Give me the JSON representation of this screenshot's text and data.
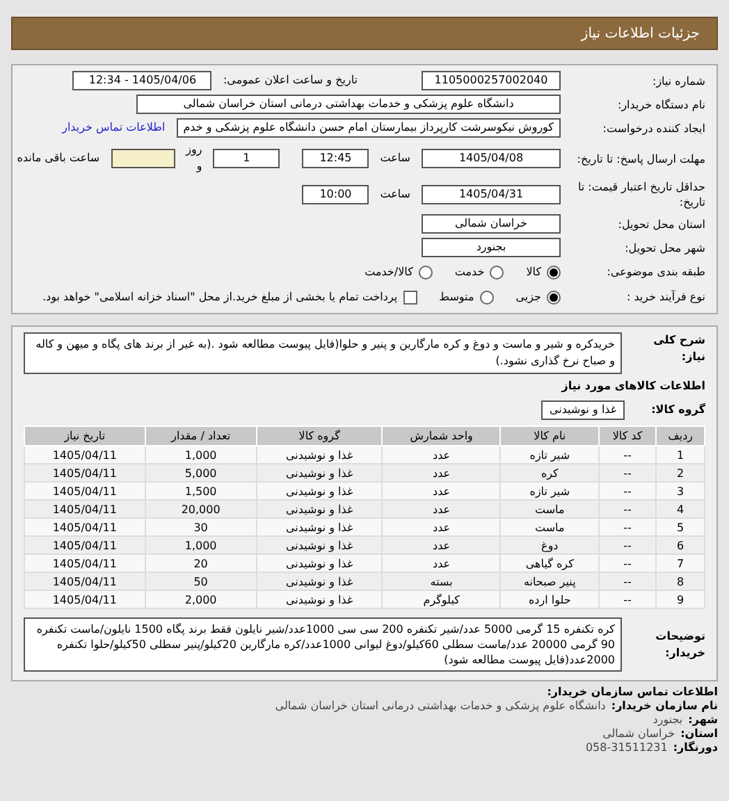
{
  "header": {
    "title": "جزئیات اطلاعات نیاز"
  },
  "details": {
    "need_number": {
      "label": "شماره نیاز:",
      "value": "1105000257002040"
    },
    "announce": {
      "label": "تاریخ و ساعت اعلان عمومی:",
      "value": "1405/04/06 - 12:34"
    },
    "buyer": {
      "label": "نام دستگاه خریدار:",
      "value": "دانشگاه علوم پزشکی و خدمات بهداشتی درمانی استان خراسان شمالی"
    },
    "creator": {
      "label": "ایجاد کننده درخواست:",
      "value": "کوروش نیکوسرشت کارپرداز بیمارستان امام حسن دانشگاه علوم پزشکی و خدم",
      "link": "اطلاعات تماس خریدار"
    },
    "deadline": {
      "label": "مهلت ارسال پاسخ: تا تاریخ:",
      "date": "1405/04/08",
      "time_label": "ساعت",
      "time": "12:45",
      "days": "1",
      "days_label": "روز و",
      "remaining_label": "ساعت باقی مانده"
    },
    "validity": {
      "label": "حداقل تاریخ اعتبار قیمت: تا تاریخ:",
      "date": "1405/04/31",
      "time_label": "ساعت",
      "time": "10:00"
    },
    "province": {
      "label": "استان محل تحویل:",
      "value": "خراسان شمالی"
    },
    "city": {
      "label": "شهر محل تحویل:",
      "value": "بجنورد"
    },
    "category": {
      "label": "طبقه بندی موضوعی:",
      "options": [
        {
          "label": "کالا",
          "selected": true
        },
        {
          "label": "خدمت",
          "selected": false
        },
        {
          "label": "کالا/خدمت",
          "selected": false
        }
      ]
    },
    "process": {
      "label": "نوع فرآیند خرید :",
      "options": [
        {
          "label": "جزیی",
          "selected": true
        },
        {
          "label": "متوسط",
          "selected": false
        }
      ],
      "treasury": {
        "label": "پرداخت تمام یا بخشی از مبلغ خرید.از محل \"اسناد خزانه اسلامی\" خواهد بود.",
        "checked": false
      }
    }
  },
  "need": {
    "description_label": "شرح کلی نیاز:",
    "description": "خریدکره و شیر و ماست و دوغ و کره مارگارین و پنیر و حلوا(فایل پیوست مطالعه شود .(به غیر از برند های پگاه و میهن و کاله و صباح نرخ گذاری نشود.)",
    "items_heading": "اطلاعات کالاهای مورد نیاز",
    "group_label": "گروه کالا:",
    "group": "غذا و نوشیدنی",
    "table": {
      "columns": [
        "ردیف",
        "کد کالا",
        "نام کالا",
        "واحد شمارش",
        "گروه کالا",
        "تعداد / مقدار",
        "تاریخ نیاز"
      ],
      "rows": [
        [
          "1",
          "--",
          "شیر تازه",
          "عدد",
          "غذا و نوشیدنی",
          "1,000",
          "1405/04/11"
        ],
        [
          "2",
          "--",
          "کره",
          "عدد",
          "غذا و نوشیدنی",
          "5,000",
          "1405/04/11"
        ],
        [
          "3",
          "--",
          "شیر تازه",
          "عدد",
          "غذا و نوشیدنی",
          "1,500",
          "1405/04/11"
        ],
        [
          "4",
          "--",
          "ماست",
          "عدد",
          "غذا و نوشیدنی",
          "20,000",
          "1405/04/11"
        ],
        [
          "5",
          "--",
          "ماست",
          "عدد",
          "غذا و نوشیدنی",
          "30",
          "1405/04/11"
        ],
        [
          "6",
          "--",
          "دوغ",
          "عدد",
          "غذا و نوشیدنی",
          "1,000",
          "1405/04/11"
        ],
        [
          "7",
          "--",
          "کره گیاهی",
          "عدد",
          "غذا و نوشیدنی",
          "20",
          "1405/04/11"
        ],
        [
          "8",
          "--",
          "پنیر صبحانه",
          "بسته",
          "غذا و نوشیدنی",
          "50",
          "1405/04/11"
        ],
        [
          "9",
          "--",
          "حلوا ارده",
          "کیلوگرم",
          "غذا و نوشیدنی",
          "2,000",
          "1405/04/11"
        ]
      ]
    },
    "notes_label": "توضیحات خریدار:",
    "notes": "کره تکنفره 15 گرمی 5000 عدد/شیر تکنفره 200 سی سی 1000عدد/شیر نایلون فقط برند پگاه 1500 نایلون/ماست تکنفره 90 گرمی 20000 عدد/ماست سطلی 60کیلو/دوغ لیوانی 1000عدد/کره مارگارین 20کیلو/پنیر سطلی 50کیلو/حلوا تکنفره 2000عدد(فایل پیوست مطالعه شود)"
  },
  "contact": {
    "heading": "اطلاعات تماس سازمان خریدار:",
    "lines": [
      {
        "label": "نام سازمان خریدار:",
        "value": "دانشگاه علوم پزشکی و خدمات بهداشتی درمانی استان خراسان شمالی"
      },
      {
        "label": "شهر:",
        "value": "بجنورد"
      },
      {
        "label": "استان:",
        "value": "خراسان شمالی"
      },
      {
        "label": "دورنگار:",
        "value": "058-31511231"
      }
    ]
  }
}
